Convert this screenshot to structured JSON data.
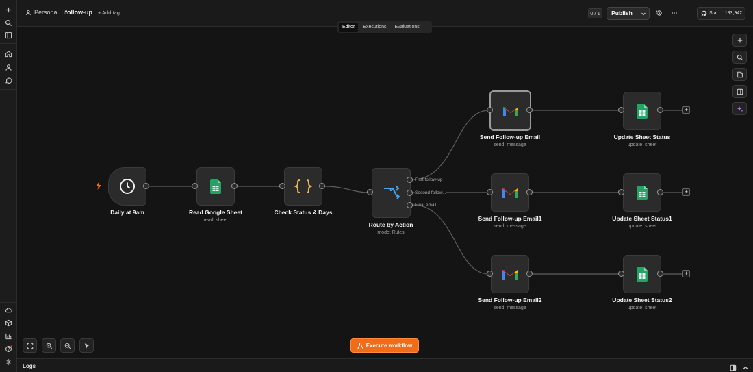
{
  "header": {
    "project": "Personal",
    "workflow_name": "follow-up",
    "add_tag": "+ Add tag",
    "counter": "0 / 1",
    "publish_label": "Publish",
    "github_star_label": "Star",
    "github_stars": "193,942"
  },
  "tabs": [
    {
      "label": "Editor",
      "active": true
    },
    {
      "label": "Executions",
      "active": false
    },
    {
      "label": "Evaluations",
      "active": false
    }
  ],
  "nodes": {
    "daily": {
      "title": "Daily at 9am",
      "icon": "clock-icon"
    },
    "read_sheet": {
      "title": "Read Google Sheet",
      "subtitle": "read: sheet",
      "icon": "google-sheets-icon"
    },
    "check_status": {
      "title": "Check Status & Days",
      "icon": "code-braces-icon"
    },
    "route": {
      "title": "Route by Action",
      "subtitle": "mode: Rules",
      "icon": "switch-icon",
      "outputs": [
        "First follow-up",
        "Second follow...",
        "Final email"
      ]
    },
    "email1": {
      "title": "Send Follow-up Email",
      "subtitle": "send: message",
      "icon": "gmail-icon",
      "selected": true
    },
    "email2": {
      "title": "Send Follow-up Email1",
      "subtitle": "send: message",
      "icon": "gmail-icon"
    },
    "email3": {
      "title": "Send Follow-up Email2",
      "subtitle": "send: message",
      "icon": "gmail-icon"
    },
    "update1": {
      "title": "Update Sheet Status",
      "subtitle": "update: sheet",
      "icon": "google-sheets-icon"
    },
    "update2": {
      "title": "Update Sheet Status1",
      "subtitle": "update: sheet",
      "icon": "google-sheets-icon"
    },
    "update3": {
      "title": "Update Sheet Status2",
      "subtitle": "update: sheet",
      "icon": "google-sheets-icon"
    }
  },
  "execute_label": "Execute workflow",
  "logs_label": "Logs",
  "colors": {
    "accent": "#ef6c1b",
    "canvas": "#141414",
    "sheets_green": "#21a464",
    "node_bg": "#2b2b2b",
    "edge": "#5f5f5f"
  }
}
